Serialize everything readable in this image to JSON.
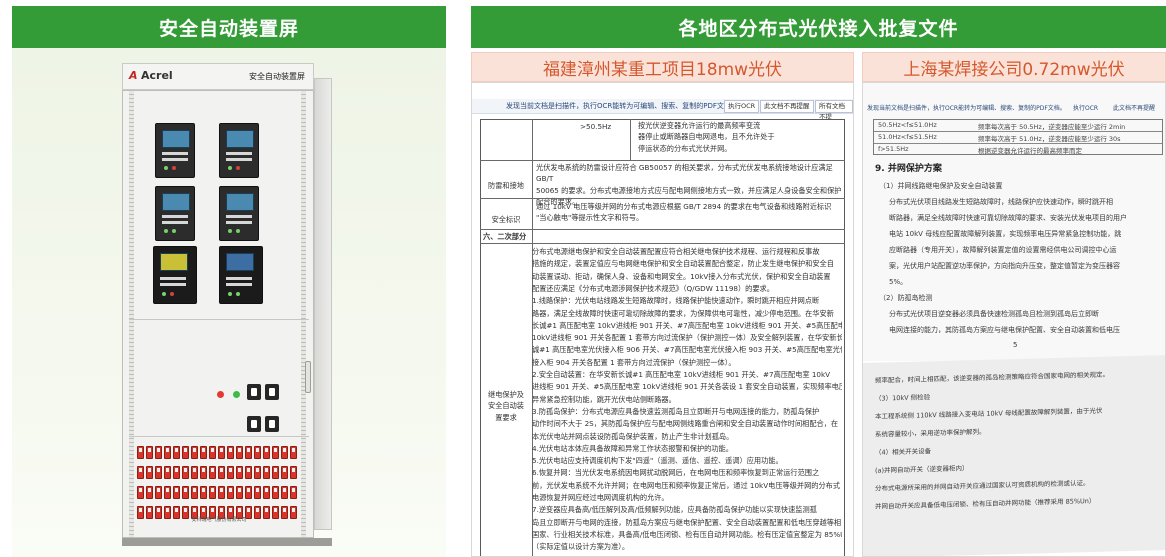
{
  "left": {
    "header": "安全自动装置屏",
    "cabinet": {
      "brand_mark": "A",
      "brand": "Acrel",
      "title": "安全自动装置屏",
      "footer": "安科瑞电气股份有限公司"
    }
  },
  "right": {
    "header": "各地区分布式光伏接入批复文件",
    "doc1": {
      "caption": "福建漳州某重工项目18mw光伏",
      "toolbar": {
        "tip": "发现当前文档是扫描件，执行OCR能转为可编辑、搜索、复制的PDF文档。",
        "btn1": "执行OCR",
        "btn2": "此文档不再提醒",
        "btn3": "所有文档不提"
      },
      "rows": [
        {
          "left": "",
          "mid": ">50.5Hz",
          "right": "按光伏逆变器允许运行的最高频率变流\n器停止或断路器自电网退电，且不允许处于\n停运状态的分布式光伏并网。"
        },
        {
          "label": "防雷和接地",
          "text": "光伏发电系统的防雷设计应符合 GB50057 的相关要求，分布式光伏发电系统接地设计应满足 GB/T\n50065 的要求。分布式电源接地方式应与配电网侧接地方式一致，并应满足人身设备安全和保护\n配合的要求。"
        },
        {
          "label": "安全标识",
          "text": "通过 10kV 电压等级并网的分布式电源应根据 GB/T 2894 的要求在电气设备和线路附近标识\n\"当心触电\"等提示性文字和符号。"
        }
      ],
      "section": "六、二次部分",
      "body_label": "继电保护及\n安全自动装\n置要求",
      "body_lines": [
        "分布式电源继电保护和安全自动装置配置应符合相关继电保护技术规程、运行规程和反事故",
        "措施的规定，装置定值应与电网继电保护和安全自动装置配合整定，防止发生继电保护和安全自",
        "动装置误动、拒动，确保人身、设备和电网安全。10kV接入分布式光伏，保护和安全自动装置",
        "配置还应满足《分布式电源涉网保护技术规范》（Q/GDW 11198）的要求。",
        "1.线路保护：光伏电站线路发生短路故障时，线路保护能快速动作，瞬时跳开相应并网点断",
        "路器，满足全线故障时快速可靠切除故障的要求，为保障供电可靠性，减少停电范围。在华安新",
        "长诚#1 高压配电室 10kV进线柜 901 开关、#7高压配电室 10kV进线柜 901 开关、#5高压配电室",
        "10kV进线柜 901 开关各配置 1 套带方向过流保护（保护测控一体）及安全解列装置，在华安新长",
        "诚#1 高压配电室光伏接入柜 906 开关、#7高压配电室光伏接入柜 903 开关、#5高压配电室光伏",
        "接入柜 904 开关各配置 1 套带方向过流保护（保护测控一体）。",
        "2.安全自动装置：在华安新长诚#1 高压配电室 10kV进线柜 901 开关、#7高压配电室 10kV",
        "进线柜 901 开关、#5高压配电室 10kV进线柜 901 开关各装设 1 套安全自动装置，实现频率电压",
        "异常紧急控制功能，跳开光伏电站侧断路器。",
        "3.防孤岛保护：分布式电源应具备快速监测孤岛且立即断开与电网连接的能力，防孤岛保护",
        "动作时间不大于 2S，其防孤岛保护应与配电网侧线路重合闸和安全自动装置动作时间相配合，在",
        "本光伏电站并网点装设防孤岛保护装置，防止产生非计划孤岛。",
        "4.光伏电站本体应具备故障和异常工作状态报警和保护的功能。",
        "5.光伏电站应支持调度机构下发\"四遥\"（遥测、遥信、遥控、遥调）应用功能。",
        "6.恢复并网：当光伏发电系统因电网扰动脱网后，在电网电压和频率恢复到正常运行范围之",
        "前，光伏发电系统不允许并网；在电网电压和频率恢复正常后，通过 10kV电压等级并网的分布式",
        "电源恢复并网应经过电网调度机构的允许。",
        "7.逆变器应具备高/低压解列及高/低频解列功能，应具备防孤岛保护功能以实现快速监测孤",
        "岛且立即断开与电网的连接，防孤岛方案应与继电保护配置、安全自动装置配置和低电压穿越等相",
        "国家、行业相关技术标准，具备高/低电压闭锁、检有压自动并网功能。检有压定值宜整定为 85%U",
        "（实际定值以设计方案为准）。"
      ]
    },
    "doc2": {
      "caption": "上海某焊接公司0.72mw光伏",
      "toolbar": {
        "tip": "发现当前文档是扫描件，执行OCR能转为可编辑、搜索、复制的PDF文档。",
        "btn1": "执行OCR",
        "btn2": "此文档不再提醒"
      },
      "table_rows": [
        {
          "a": "50.5Hz<f≤51.0Hz",
          "b": "频率每次高于 50.5Hz，逆变器应能至少运行 2min"
        },
        {
          "a": "51.0Hz<f≤51.5Hz",
          "b": "频率每次高于 51.0Hz，逆变器应能至少运行 30s"
        },
        {
          "a": "f>51.5Hz",
          "b": "根据逆变器允许运行的最高频率而定"
        }
      ],
      "heading": "9. 并网保护方案",
      "lines": [
        "（1）并网线路继电保护及安全自动装置",
        "分布式光伏项目线路发生短路故障时，线路保护应快速动作，瞬时跳开相",
        "断路器，满足全线故障时快速可靠切除故障的要求、安装光伏发电项目的用户",
        "电站 10kV 母线应配置故障解列装置，实现频率电压异常紧急控制功能，跳",
        "应断路器（专用开关），故障解列装置定值的设置需经供电公司调控中心运",
        "案，光伏用户站配置逆功率保护，方向指向升压变，整定值暂定为变压器容",
        "5%。",
        "（2）防孤岛检测",
        "分布式光伏项目逆变器必须具备快速检测孤岛且检测到孤岛后立即断",
        "电网连接的能力，其防孤岛方案应与继电保护配置、安全自动装置和低电压",
        "5"
      ],
      "lines2": [
        "频率配合，时间上相匹配，该逆变器的孤岛检测策略应符合国家电网的相关规定。",
        "（3）10kV 侧检验",
        "本工程系统侧 110kV 线路接入变电站 10kV 母线配置故障解列装置，由于光伏",
        "系统容量较小，采用逆功率保护解列。",
        "（4）相关开关设备",
        "(a)并网自动开关（逆变器柜内）",
        "分布式电源所采用的并网自动开关应通过国家认可资质机构的检测或认证。",
        "并网自动开关应具备低电压闭锁、检有压自动并网功能（推荐采用 85%Un）"
      ]
    }
  }
}
